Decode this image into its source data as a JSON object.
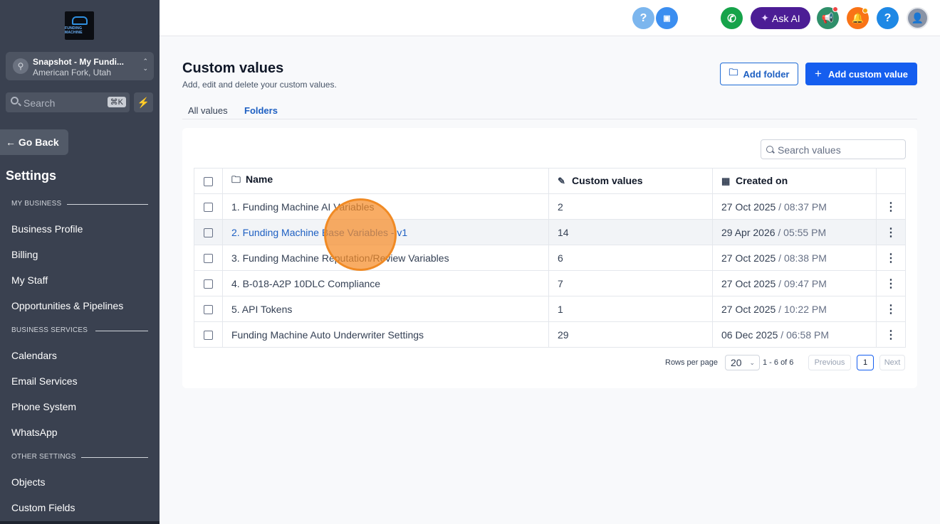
{
  "sidebar": {
    "logo_text": "FUNDING MACHINE",
    "account": {
      "name": "Snapshot - My Fundi...",
      "location": "American Fork, Utah"
    },
    "search": {
      "label": "Search",
      "shortcut": "⌘K"
    },
    "go_back": "Go Back",
    "title": "Settings",
    "sections": [
      {
        "label": "MY BUSINESS"
      },
      {
        "label": "BUSINESS SERVICES"
      },
      {
        "label": "OTHER SETTINGS"
      }
    ],
    "items": [
      {
        "label": "Business Profile"
      },
      {
        "label": "Billing"
      },
      {
        "label": "My Staff"
      },
      {
        "label": "Opportunities & Pipelines"
      },
      {
        "label": "Calendars"
      },
      {
        "label": "Email Services"
      },
      {
        "label": "Phone System"
      },
      {
        "label": "WhatsApp"
      },
      {
        "label": "Objects"
      },
      {
        "label": "Custom Fields"
      }
    ]
  },
  "topbar": {
    "help_icon": "question-icon",
    "ask_ai_label": "Ask AI",
    "colors": {
      "help": "#5fa8f0",
      "id_card": "#3b82f6",
      "phone": "#16a34a",
      "ask_ai": "#4c1d95",
      "megaphone": "#2f8f6a",
      "bell": "#f97316",
      "help2": "#1e88e5"
    }
  },
  "page": {
    "title": "Custom values",
    "subtitle": "Add, edit and delete your custom values.",
    "add_folder_label": "Add folder",
    "add_value_label": "Add custom value",
    "tabs": [
      {
        "label": "All values"
      },
      {
        "label": "Folders"
      }
    ],
    "active_tab": "Folders",
    "search_placeholder": "Search values"
  },
  "table": {
    "columns": {
      "name": "Name",
      "count": "Custom values",
      "created": "Created on"
    },
    "rows": [
      {
        "name": "1. Funding Machine AI Variables",
        "count": "2",
        "date": "27 Oct 2025",
        "time": "/ 08:37 PM"
      },
      {
        "name": "2. Funding Machine Base Variables - v1",
        "count": "14",
        "date": "29 Apr 2026",
        "time": "/ 05:55 PM"
      },
      {
        "name": "3. Funding Machine Reputation/Review Variables",
        "count": "6",
        "date": "27 Oct 2025",
        "time": "/ 08:38 PM"
      },
      {
        "name": "4. B-018-A2P 10DLC Compliance",
        "count": "7",
        "date": "27 Oct 2025",
        "time": "/ 09:47 PM"
      },
      {
        "name": "5. API Tokens",
        "count": "1",
        "date": "27 Oct 2025",
        "time": "/ 10:22 PM"
      },
      {
        "name": "Funding Machine Auto Underwriter Settings",
        "count": "29",
        "date": "06 Dec 2025",
        "time": "/ 06:58 PM"
      }
    ]
  },
  "pagination": {
    "rows_label": "Rows per page",
    "rows_value": "20",
    "range": "1 - 6 of 6",
    "previous": "Previous",
    "current": "1",
    "next": "Next"
  }
}
